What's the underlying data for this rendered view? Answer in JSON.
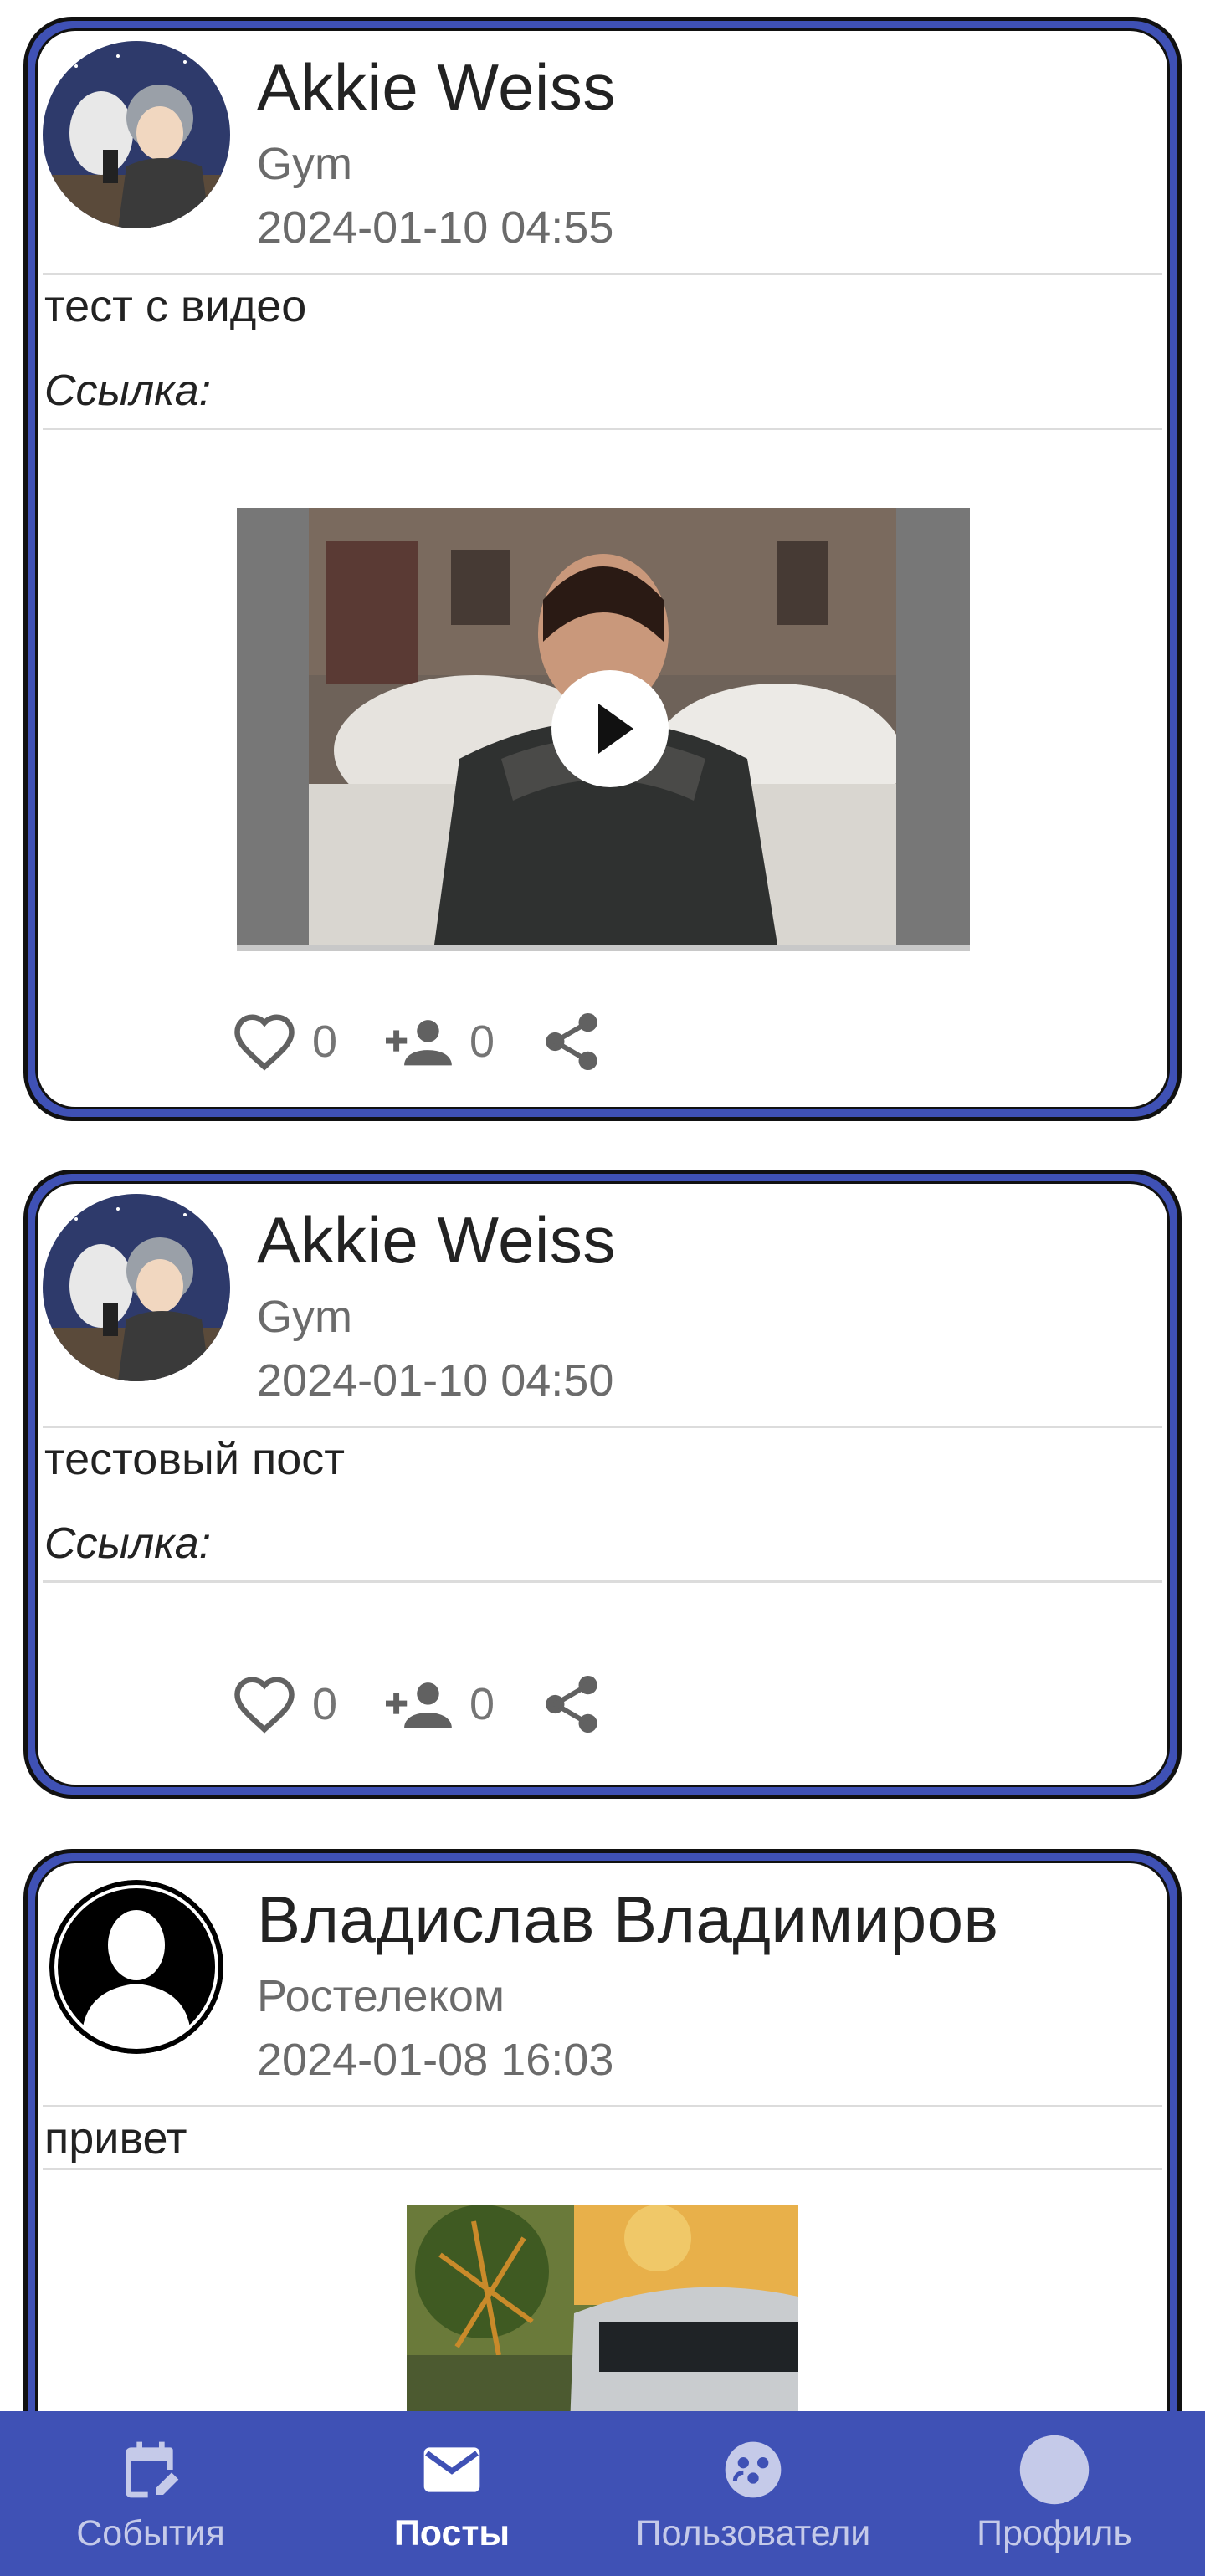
{
  "posts": [
    {
      "author": "Akkie Weiss",
      "organization": "Gym",
      "date": "2024-01-10 04:55",
      "text": "тест с видео",
      "link_label": "Ссылка:",
      "likes": "0",
      "subscribers": "0",
      "media": "video"
    },
    {
      "author": "Akkie Weiss",
      "organization": "Gym",
      "date": "2024-01-10 04:50",
      "text": "тестовый пост",
      "link_label": "Ссылка:",
      "likes": "0",
      "subscribers": "0",
      "media": "none"
    },
    {
      "author": "Владислав Владимиров",
      "organization": "Ростелеком",
      "date": "2024-01-08 16:03",
      "text": "привет",
      "media": "image"
    }
  ],
  "bottom_nav": {
    "items": [
      {
        "label": "События",
        "icon": "calendar-edit-icon",
        "active": false
      },
      {
        "label": "Посты",
        "icon": "mail-icon",
        "active": true
      },
      {
        "label": "Пользователи",
        "icon": "users-group-icon",
        "active": false
      },
      {
        "label": "Профиль",
        "icon": "profile-avatar-icon",
        "active": false
      }
    ]
  },
  "colors": {
    "primary": "#3f51b5",
    "nav_inactive": "#c5cae9",
    "secondary_text": "#6b6b6b",
    "icon_gray": "#616161"
  }
}
